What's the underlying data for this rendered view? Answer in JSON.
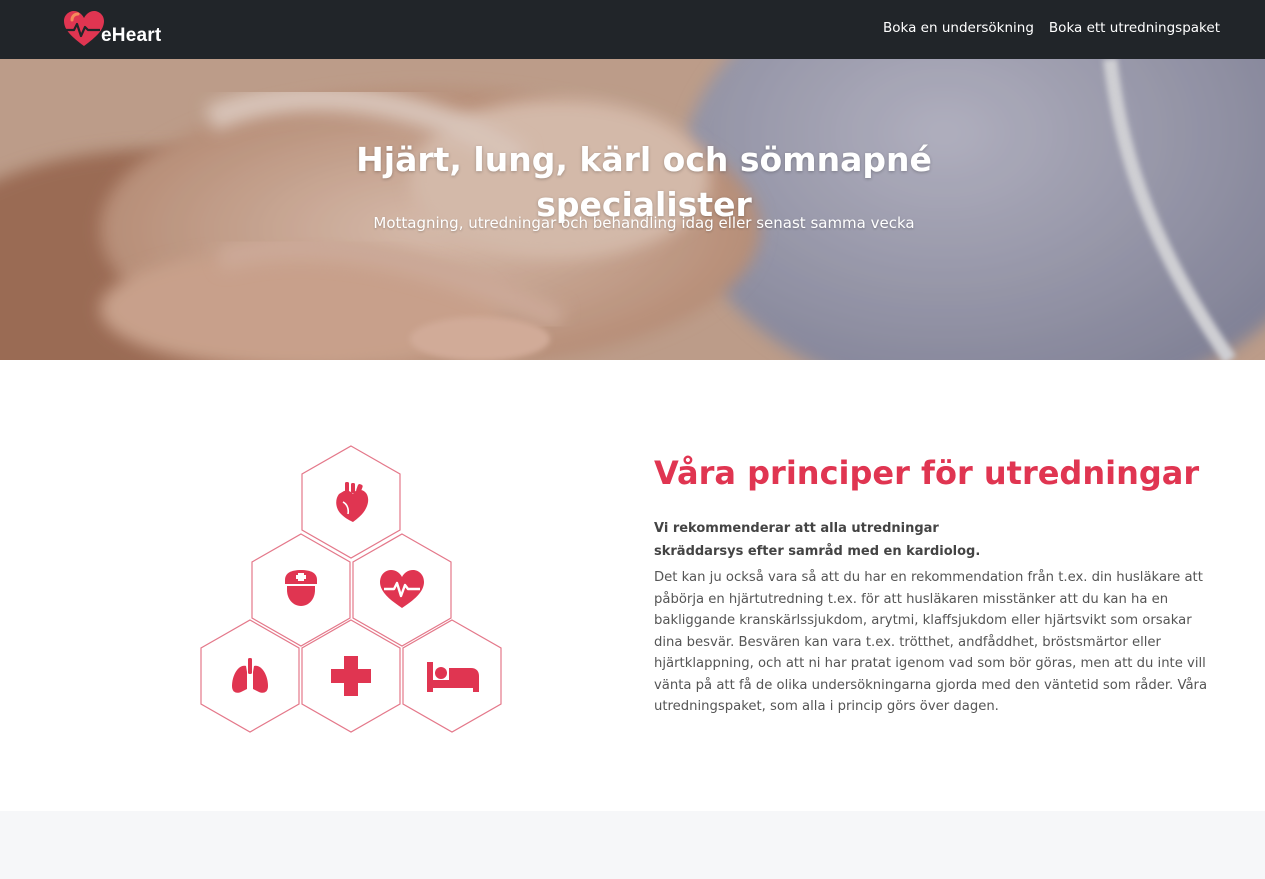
{
  "brand": {
    "name": "eHeart",
    "accent": "#e03551"
  },
  "nav": {
    "links": [
      "Boka en undersökning",
      "Boka ett utredningspaket"
    ]
  },
  "hero": {
    "title": "Hjärt, lung, kärl och sömnapné specialister",
    "subtitle": "Mottagning, utredningar och behandling idag eller senast samma vecka"
  },
  "principles": {
    "title": "Våra principer för utredningar",
    "lead_line1": "Vi rekommenderar att alla utredningar",
    "lead_line2": "skräddarsys efter samråd med en kardiolog.",
    "body": "Det kan ju också vara så att du har en rekommendation från t.ex. din husläkare att påbörja en hjärtutredning t.ex. för att husläkaren misstänker att du kan ha en bakliggande kranskärlssjukdom, arytmi, klaffsjukdom eller hjärtsvikt som orsakar dina besvär. Besvären kan vara t.ex. trötthet, andfåddhet, bröstsmärtor eller hjärtklappning, och att ni har pratat igenom vad som bör göras, men att du inte vill vänta på att få de olika undersökningarna gjorda med den väntetid som råder. Våra utredningspaket, som alla i princip görs över dagen.",
    "icons": [
      "heart-organ-icon",
      "nurse-icon",
      "heartbeat-icon",
      "lungs-icon",
      "medical-cross-icon",
      "bed-icon"
    ]
  }
}
